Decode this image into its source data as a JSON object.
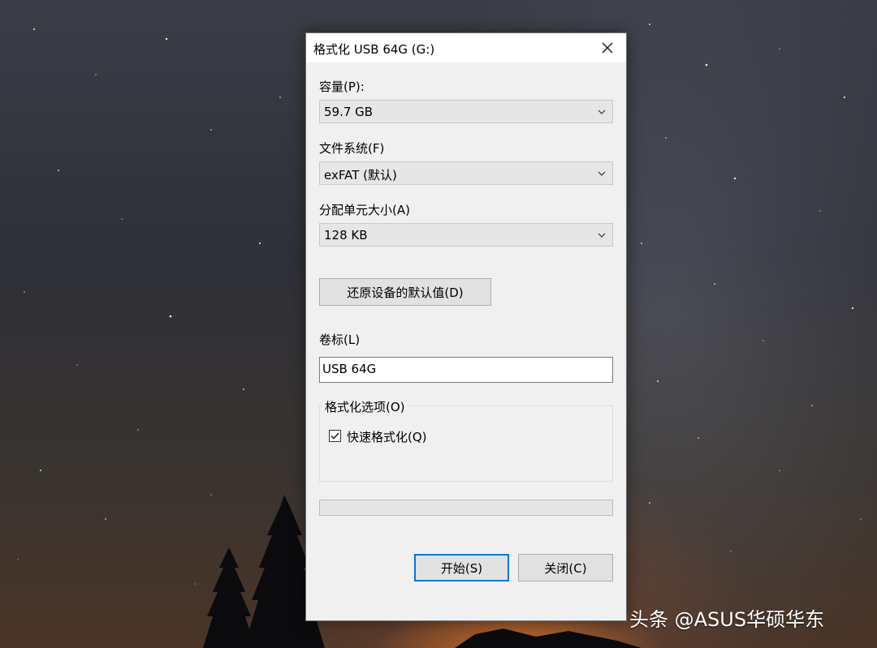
{
  "dialog": {
    "title": "格式化 USB 64G (G:)",
    "capacity": {
      "label": "容量(P):",
      "value": "59.7 GB"
    },
    "file_system": {
      "label": "文件系统(F)",
      "value": "exFAT (默认)"
    },
    "allocation": {
      "label": "分配单元大小(A)",
      "value": "128 KB"
    },
    "restore_defaults_label": "还原设备的默认值(D)",
    "volume_label": {
      "label": "卷标(L)",
      "value": "USB 64G"
    },
    "options": {
      "legend": "格式化选项(O)",
      "quick_format": {
        "label": "快速格式化(Q)",
        "checked": true
      }
    },
    "progress": 0,
    "start_label": "开始(S)",
    "close_label": "关闭(C)"
  },
  "watermark": "头条 @ASUS华硕华东",
  "colors": {
    "accent": "#0078d7",
    "dialog_bg": "#f0f0f0",
    "titlebar_bg": "#ffffff",
    "combo_bg": "#e6e6e6",
    "button_bg": "#e1e1e1"
  },
  "icons": {
    "close": "close-icon",
    "dropdown": "chevron-down-icon",
    "checkbox": "checkmark-icon"
  }
}
